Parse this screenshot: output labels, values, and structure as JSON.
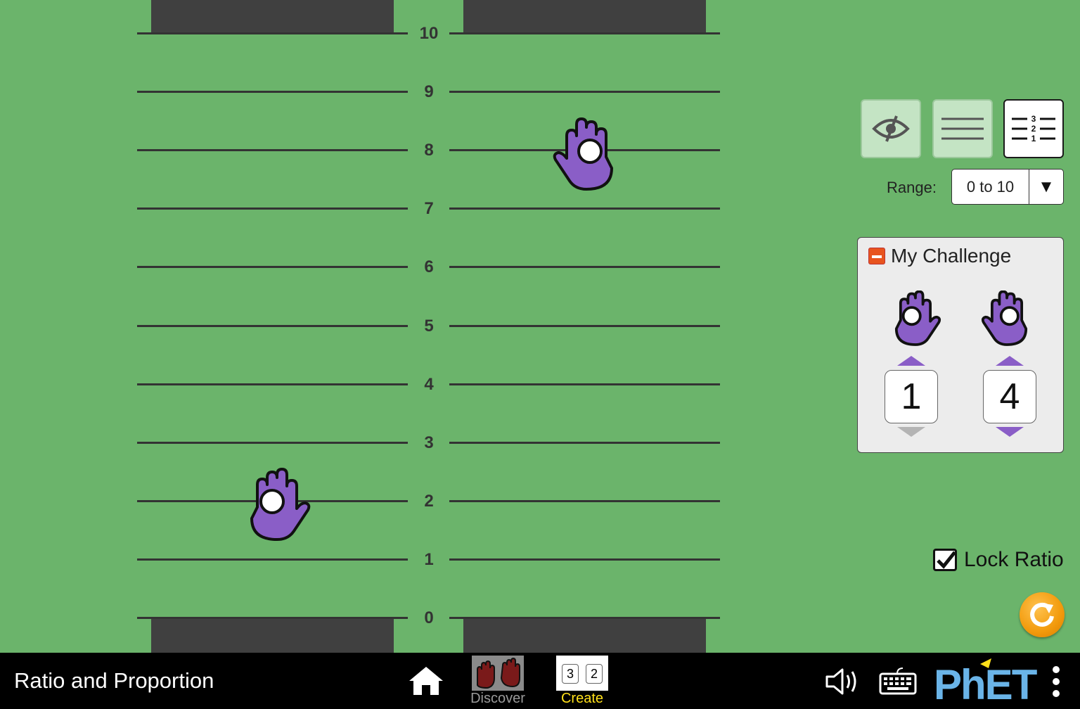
{
  "sim": {
    "tick_labels": [
      "0",
      "1",
      "2",
      "3",
      "4",
      "5",
      "6",
      "7",
      "8",
      "9",
      "10"
    ],
    "left_hand_value": 2,
    "right_hand_value": 8
  },
  "view_controls": {
    "buttons": [
      {
        "name": "hide-ticks",
        "icon": "eye-slash-icon",
        "selected": false
      },
      {
        "name": "tick-marks",
        "icon": "lines-icon",
        "selected": false
      },
      {
        "name": "tick-numbers",
        "icon": "numbered-lines-icon",
        "selected": true
      },
      {
        "numbered_icon_digits": [
          "3",
          "2",
          "1"
        ]
      }
    ]
  },
  "range": {
    "label": "Range:",
    "value": "0 to 10"
  },
  "challenge": {
    "title": "My Challenge",
    "left_value": "1",
    "right_value": "4"
  },
  "lock_ratio": {
    "label": "Lock Ratio",
    "checked": true
  },
  "navbar": {
    "app_title": "Ratio and Proportion",
    "screens": [
      {
        "label": "Discover",
        "selected": false
      },
      {
        "label": "Create",
        "selected": true
      }
    ],
    "create_icon_digits": [
      "3",
      "2"
    ],
    "brand": "PhET"
  },
  "colors": {
    "background": "#6bb46b",
    "hand": "#8a5ec7",
    "reset": "#f29a0c",
    "selected_screen": "#ffe01a"
  }
}
